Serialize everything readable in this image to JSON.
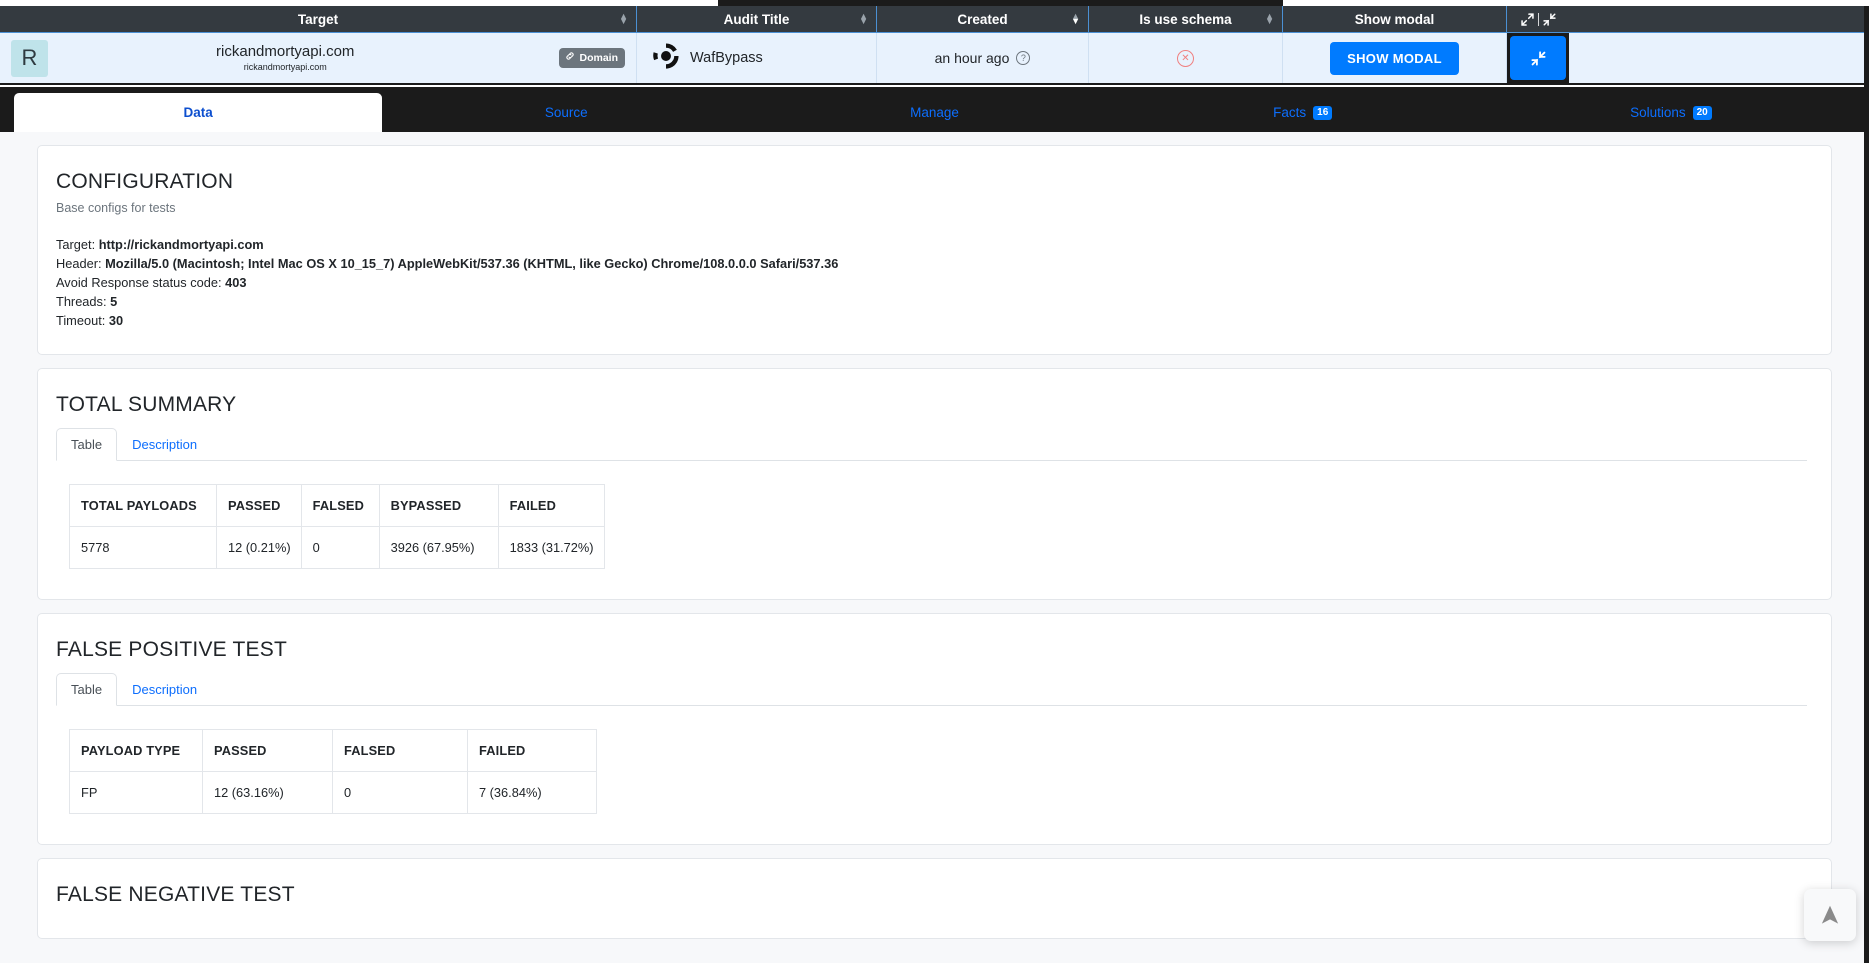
{
  "audit_table": {
    "columns": [
      {
        "label": "Target",
        "sortable": true
      },
      {
        "label": "Audit Title",
        "sortable": true
      },
      {
        "label": "Created",
        "sortable": true
      },
      {
        "label": "Is use schema",
        "sortable": true
      },
      {
        "label": "Show modal",
        "sortable": false
      }
    ],
    "tools": {
      "expand_icon": "expand-icon",
      "collapse_icon": "collapse-icon"
    },
    "row": {
      "avatar_letter": "R",
      "target_url": "rickandmortyapi.com",
      "target_subtitle": "rickandmortyapi.com",
      "domain_chip": "Domain",
      "audit_title": "WafBypass",
      "created": "an hour ago",
      "created_help_icon": "question-circle-icon",
      "is_use_schema_icon": "x-circle-icon",
      "show_modal_button": "SHOW MODAL",
      "row_collapse_icon": "collapse-icon"
    }
  },
  "nav_tabs": [
    {
      "label": "Data",
      "active": true,
      "badge": ""
    },
    {
      "label": "Source",
      "active": false,
      "badge": ""
    },
    {
      "label": "Manage",
      "active": false,
      "badge": ""
    },
    {
      "label": "Facts",
      "active": false,
      "badge": "16"
    },
    {
      "label": "Solutions",
      "active": false,
      "badge": "20"
    }
  ],
  "configuration": {
    "title": "CONFIGURATION",
    "subtitle": "Base configs for tests",
    "rows": [
      {
        "label": "Target:",
        "value": "http://rickandmortyapi.com"
      },
      {
        "label": "Header:",
        "value": "Mozilla/5.0 (Macintosh; Intel Mac OS X 10_15_7) AppleWebKit/537.36 (KHTML, like Gecko) Chrome/108.0.0.0 Safari/537.36"
      },
      {
        "label": "Avoid Response status code:",
        "value": "403"
      },
      {
        "label": "Threads:",
        "value": "5"
      },
      {
        "label": "Timeout:",
        "value": "30"
      }
    ]
  },
  "total_summary": {
    "title": "TOTAL SUMMARY",
    "tabs": [
      {
        "label": "Table",
        "active": true
      },
      {
        "label": "Description",
        "active": false
      }
    ],
    "table": {
      "headers": [
        "TOTAL PAYLOADS",
        "PASSED",
        "FALSED",
        "BYPASSED",
        "FAILED"
      ],
      "rows": [
        [
          "5778",
          "12 (0.21%)",
          "0",
          "3926 (67.95%)",
          "1833 (31.72%)"
        ]
      ]
    }
  },
  "false_positive_test": {
    "title": "FALSE POSITIVE TEST",
    "tabs": [
      {
        "label": "Table",
        "active": true
      },
      {
        "label": "Description",
        "active": false
      }
    ],
    "table": {
      "headers": [
        "PAYLOAD TYPE",
        "PASSED",
        "FALSED",
        "FAILED"
      ],
      "rows": [
        [
          "FP",
          "12 (63.16%)",
          "0",
          "7 (36.84%)"
        ]
      ]
    }
  },
  "false_negative_test": {
    "title": "FALSE NEGATIVE TEST"
  },
  "scroll_to_top": {
    "icon": "arrow-up-icon"
  },
  "colors": {
    "header_bg": "#343a40",
    "row_bg": "#e8f2fd",
    "accent_blue": "#007bff",
    "dark_panel": "#1b1b1b",
    "danger": "#f08080"
  }
}
